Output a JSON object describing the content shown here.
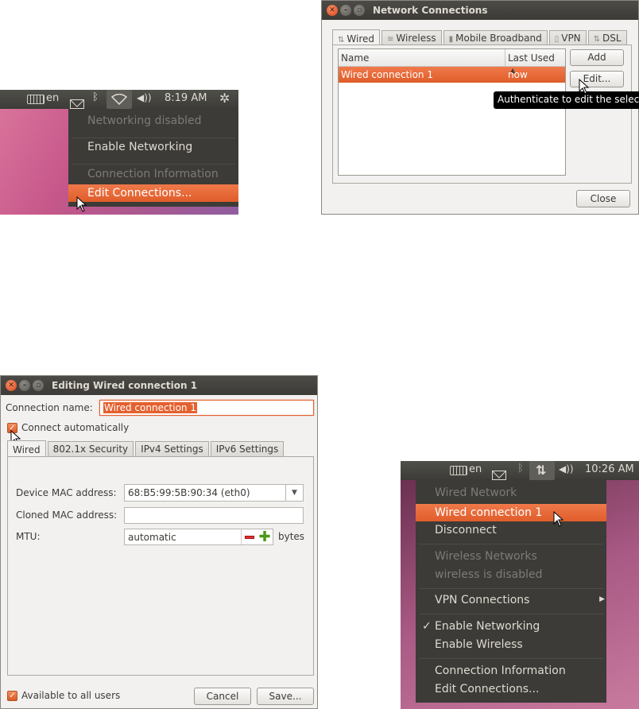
{
  "panel1": {
    "keyboard_layout": "en",
    "time": "8:19 AM",
    "icons": [
      "keyboard-icon",
      "mail-icon",
      "bluetooth-icon",
      "network-wireless-icon",
      "volume-icon",
      "gear-icon"
    ]
  },
  "menu1": {
    "items": [
      {
        "label": "Networking disabled",
        "state": "disabled"
      },
      {
        "label": "Enable Networking",
        "state": "normal"
      },
      {
        "label": "Connection Information",
        "state": "disabled"
      },
      {
        "label": "Edit Connections...",
        "state": "highlighted"
      }
    ]
  },
  "network_connections": {
    "title": "Network Connections",
    "tabs": [
      "Wired",
      "Wireless",
      "Mobile Broadband",
      "VPN",
      "DSL"
    ],
    "columns": [
      "Name",
      "Last Used"
    ],
    "sort_indicator": "▲",
    "rows": [
      {
        "name": "Wired connection 1",
        "last_used": "now"
      }
    ],
    "buttons": {
      "add": "Add",
      "edit": "Edit...",
      "close": "Close"
    },
    "tooltip": "Authenticate to edit the selecte"
  },
  "editor": {
    "title": "Editing Wired connection 1",
    "connection_name_label": "Connection name:",
    "connection_name_value": "Wired connection 1",
    "connect_automatically": "Connect automatically",
    "tabs": [
      "Wired",
      "802.1x Security",
      "IPv4 Settings",
      "IPv6 Settings"
    ],
    "device_mac_label": "Device MAC address:",
    "device_mac_value": "68:B5:99:5B:90:34 (eth0)",
    "cloned_mac_label": "Cloned MAC address:",
    "cloned_mac_value": "",
    "mtu_label": "MTU:",
    "mtu_value": "automatic",
    "mtu_unit": "bytes",
    "available_all_users": "Available to all users",
    "buttons": {
      "cancel": "Cancel",
      "save": "Save..."
    }
  },
  "panel2": {
    "keyboard_layout": "en",
    "time": "10:26 AM",
    "icons": [
      "keyboard-icon",
      "mail-icon",
      "bluetooth-icon",
      "network-wired-icon",
      "volume-icon"
    ]
  },
  "menu2": {
    "items": [
      {
        "label": "Wired Network",
        "state": "disabled"
      },
      {
        "label": "Wired connection 1",
        "state": "highlighted"
      },
      {
        "label": "Disconnect",
        "state": "normal"
      },
      {
        "label": "Wireless Networks",
        "state": "disabled"
      },
      {
        "label": "wireless is disabled",
        "state": "disabled"
      },
      {
        "label": "VPN Connections",
        "state": "normal",
        "submenu": true
      },
      {
        "label": "Enable Networking",
        "state": "checked"
      },
      {
        "label": "Enable Wireless",
        "state": "normal"
      },
      {
        "label": "Connection Information",
        "state": "normal"
      },
      {
        "label": "Edit Connections...",
        "state": "normal"
      }
    ],
    "submenu_arrow": "▶",
    "check_mark": "✓"
  },
  "colors": {
    "accent": "#e5602f",
    "panel_bg": "#3c3b37",
    "menu_text": "#dfdbd2",
    "disabled_text": "#7d7b76"
  }
}
